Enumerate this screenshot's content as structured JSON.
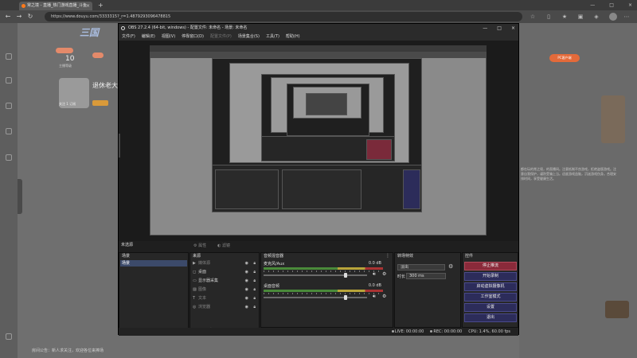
{
  "browser": {
    "tab_title": "常之境 - 直播_热门游戏直播_斗鱼",
    "tab_close": "×",
    "new_tab": "+",
    "window_controls": [
      "—",
      "□",
      "×"
    ],
    "url": "https://www.douyu.com/3333315?_r=1.4879293096478815",
    "icons": [
      "back-icon",
      "forward-icon",
      "refresh-icon",
      "star-icon",
      "split-icon",
      "favorites-icon",
      "collections-icon",
      "profile-icon",
      "more-icon"
    ]
  },
  "site": {
    "logo": "三国",
    "stat": {
      "number": "10",
      "label": "主播等级"
    },
    "streamer": {
      "name": "退休老大",
      "sub": "关注 1 订阅"
    },
    "pc_button": "PC客户端",
    "side_text": "都在玩的常之境，的直播间。注意抵制不良游戏，拒绝盗版游戏。注意自我保护，谨防受骗上当。适度游戏益脑，沉迷游戏伤身。合理安排时间，享受健康生活。",
    "notice": "房间公告：新人求关注，欢迎各位来捧场"
  },
  "obs": {
    "title": "OBS 27.2.4 (64-bit, windows) - 配置文件: 未命名 - 场景: 未命名",
    "window_controls": [
      "—",
      "□",
      "×"
    ],
    "menu": [
      "文件(F)",
      "编辑(E)",
      "视图(V)",
      "停靠窗口(D)",
      "配置文件(P)",
      "场景集合(S)",
      "工具(T)",
      "帮助(H)"
    ],
    "scene_header": "未选源",
    "toolbar": [
      "属性",
      "滤镜"
    ],
    "scenes": {
      "title": "场景",
      "items": [
        "场景"
      ]
    },
    "sources": {
      "title": "来源",
      "items": [
        {
          "name": "媒体源",
          "icon": "play-icon"
        },
        {
          "name": "桌面",
          "icon": "desktop-icon"
        },
        {
          "name": "显示器采集",
          "icon": "monitor-icon"
        },
        {
          "name": "图像",
          "icon": "image-icon"
        },
        {
          "name": "文本",
          "icon": "text-icon"
        },
        {
          "name": "浏览器",
          "icon": "browser-icon"
        }
      ]
    },
    "mixer": {
      "title": "音频混音器",
      "channels": [
        {
          "name": "麦克风/Aux",
          "db": "0.0 dB",
          "level": 0.78
        },
        {
          "name": "桌面音频",
          "db": "0.0 dB",
          "level": 0.78
        }
      ]
    },
    "transitions": {
      "title": "转场特效",
      "selected": "淡出",
      "duration_label": "时长",
      "duration": "300 ms"
    },
    "controls": {
      "title": "控件",
      "buttons": [
        "停止推流",
        "开始录制",
        "启动虚拟摄像机",
        "工作室模式",
        "设置",
        "退出"
      ]
    },
    "status": {
      "live": "LIVE: 00:00:00",
      "rec": "REC: 00:00:00",
      "cpu": "CPU: 1.4%, 60.00 fps"
    }
  }
}
